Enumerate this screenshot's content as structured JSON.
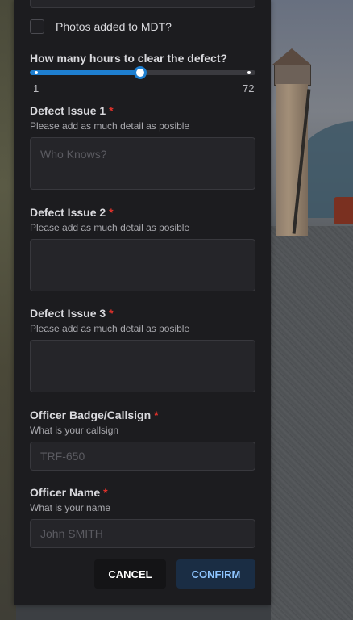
{
  "form": {
    "checkbox_label": "Photos added to MDT?",
    "checkbox_checked": false,
    "slider": {
      "label": "How many hours to clear the defect?",
      "min": 1,
      "max": 72,
      "min_label": "1",
      "max_label": "72",
      "value_fraction": 0.49,
      "accent": "#1e7fd0"
    },
    "fields": [
      {
        "label": "Defect Issue 1",
        "help": "Please add as much detail as posible",
        "placeholder": "Who Knows?"
      },
      {
        "label": "Defect Issue 2",
        "help": "Please add as much detail as posible",
        "placeholder": ""
      },
      {
        "label": "Defect Issue 3",
        "help": "Please add as much detail as posible",
        "placeholder": ""
      },
      {
        "label": "Officer Badge/Callsign",
        "help": "What is your callsign",
        "placeholder": "TRF-650"
      },
      {
        "label": "Officer Name",
        "help": "What is your name",
        "placeholder": "John SMITH"
      }
    ],
    "required_marker": "*",
    "buttons": {
      "cancel": "CANCEL",
      "confirm": "CONFIRM"
    }
  },
  "colors": {
    "panel": "#1c1c1f",
    "required": "#e5322b",
    "confirm_text": "#8ec5ff"
  }
}
